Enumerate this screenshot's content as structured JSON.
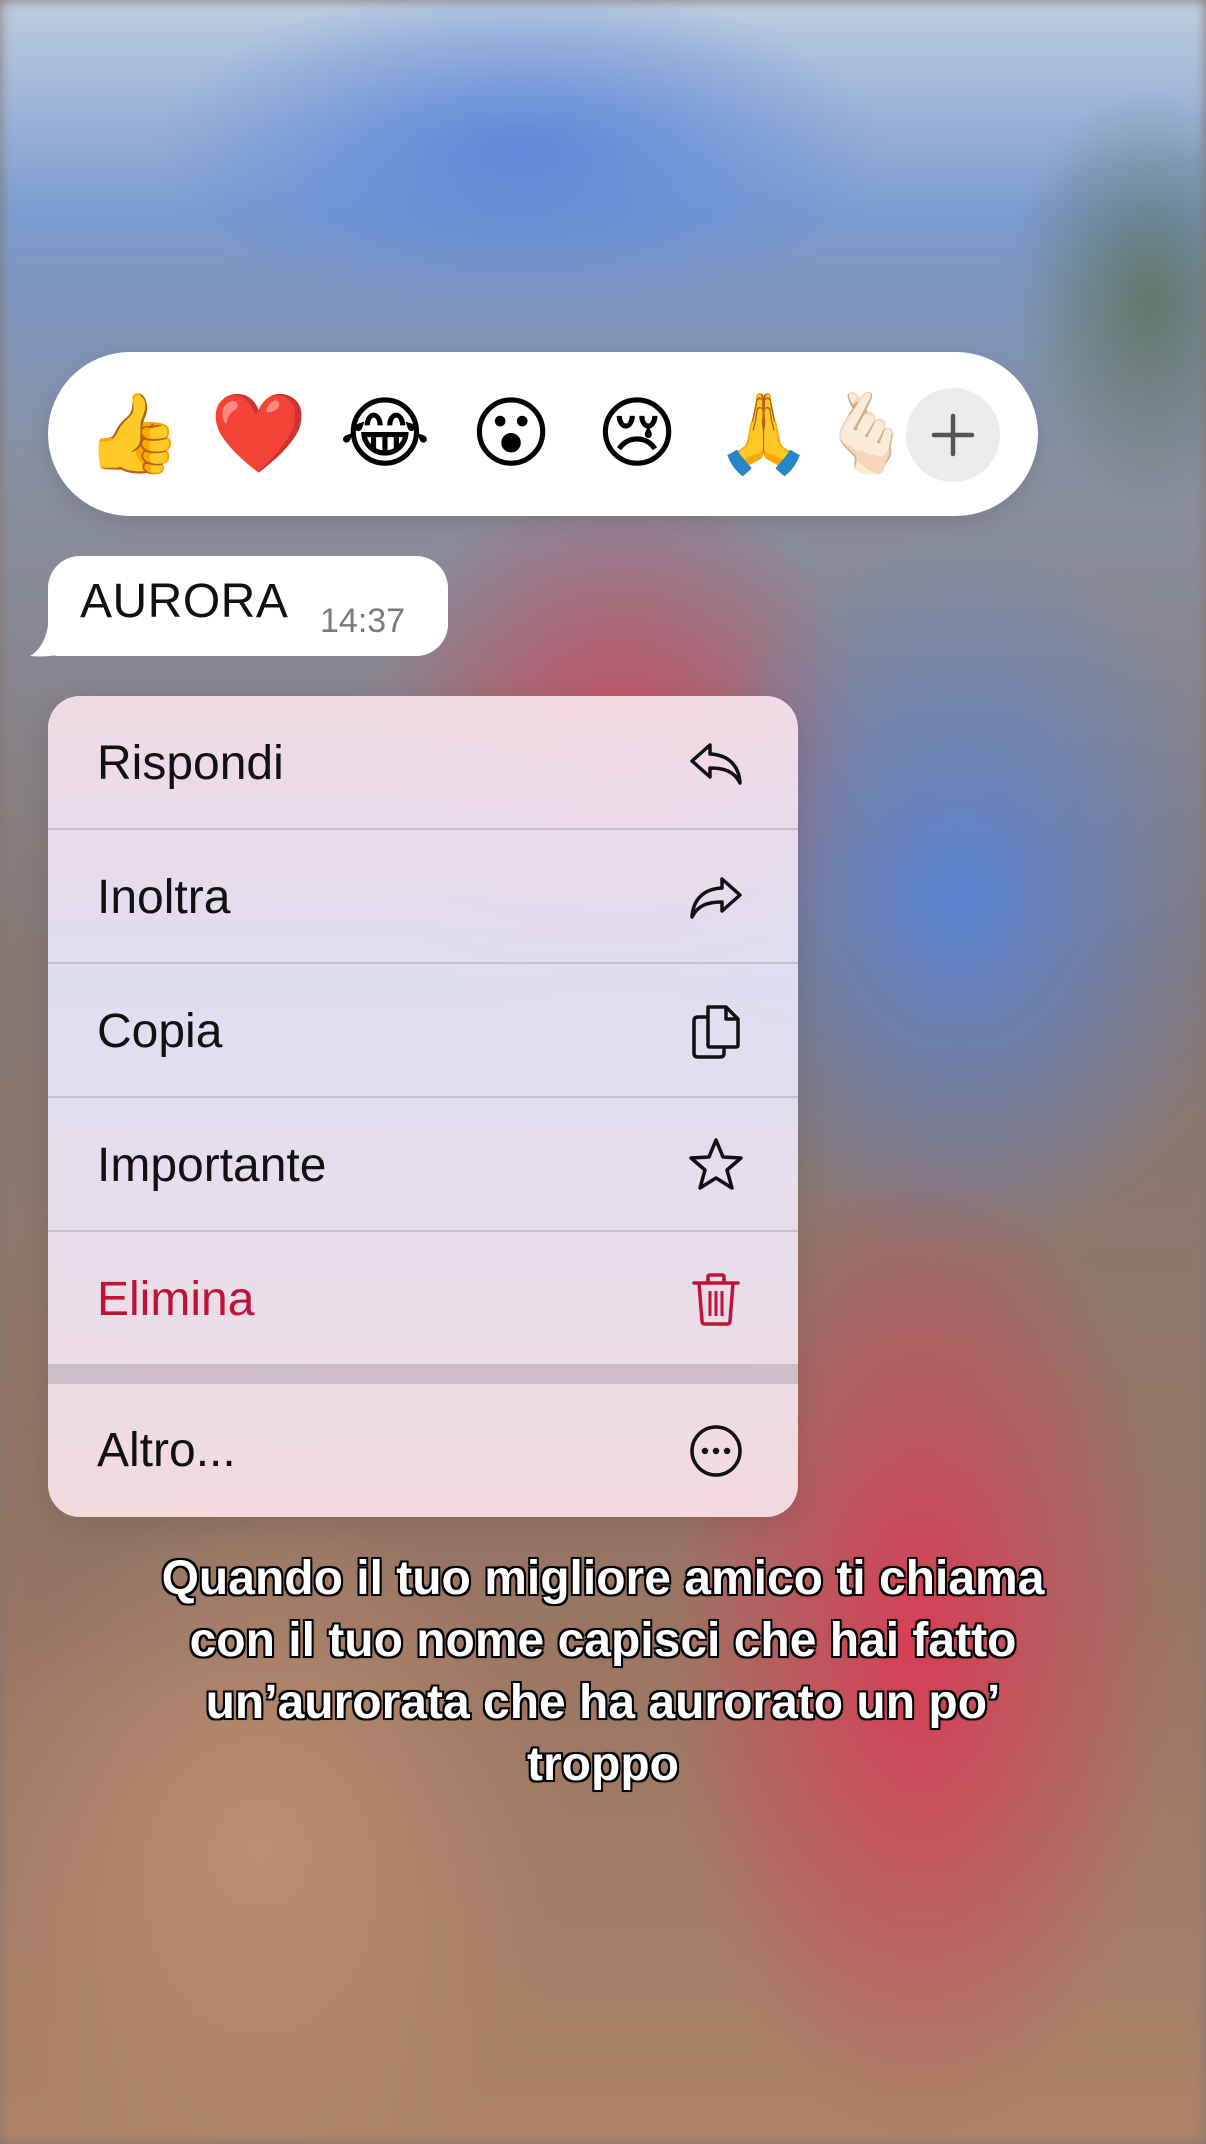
{
  "reactions": {
    "emojis": [
      {
        "glyph": "👍",
        "name": "thumbs-up"
      },
      {
        "glyph": "❤️",
        "name": "red-heart"
      },
      {
        "glyph": "😂",
        "name": "tears-of-joy"
      },
      {
        "glyph": "😮",
        "name": "open-mouth"
      },
      {
        "glyph": "😢",
        "name": "crying-face"
      },
      {
        "glyph": "🙏",
        "name": "folded-hands"
      },
      {
        "glyph": "🫰🏻",
        "name": "hand-partial"
      }
    ],
    "more_icon": "plus-icon"
  },
  "message": {
    "text": "AURORA",
    "time": "14:37"
  },
  "menu": {
    "items": [
      {
        "label": "Rispondi",
        "icon": "reply-icon"
      },
      {
        "label": "Inoltra",
        "icon": "forward-icon"
      },
      {
        "label": "Copia",
        "icon": "copy-icon"
      },
      {
        "label": "Importante",
        "icon": "star-icon"
      },
      {
        "label": "Elimina",
        "icon": "trash-icon",
        "color": "#c0113b"
      }
    ],
    "more": {
      "label": "Altro...",
      "icon": "ellipsis-circle-icon"
    }
  },
  "caption": {
    "lines": [
      "Quando il tuo migliore amico ti chiama",
      "con il tuo nome capisci che hai fatto",
      "un’aurorata che ha aurorato un po’",
      "troppo"
    ]
  }
}
